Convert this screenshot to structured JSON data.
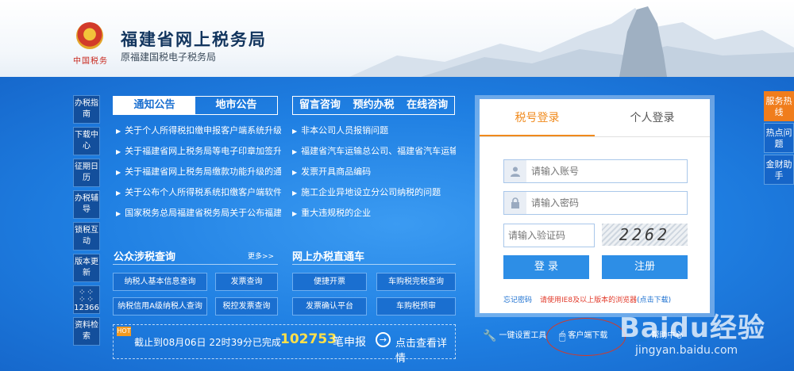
{
  "header": {
    "emblem_text": "中国税务",
    "title": "福建省网上税务局",
    "subtitle": "原福建国税电子税务局"
  },
  "sidenav": [
    {
      "label": "办税指南"
    },
    {
      "label": "下载中心"
    },
    {
      "label": "征期日历"
    },
    {
      "label": "办税辅导"
    },
    {
      "label": "锁税互动"
    },
    {
      "label": "版本更新"
    },
    {
      "label": "12366"
    },
    {
      "label": "资料检索"
    }
  ],
  "notice_tabs": [
    "通知公告",
    "地市公告"
  ],
  "notices": [
    "关于个人所得税扣缴申报客户端系统升级",
    "关于福建省网上税务局等电子印章加签升",
    "关于福建省网上税务局缴款功能升级的通",
    "关于公布个人所得税系统扣缴客户端软件",
    "国家税务总局福建省税务局关于公布福建"
  ],
  "consult_tabs": [
    "留言咨询",
    "预约办税",
    "在线咨询"
  ],
  "consults": [
    "非本公司人员报销问题",
    "福建省汽车运输总公司、福建省汽车运输",
    "发票开具商品编码",
    "施工企业异地设立分公司纳税的问题",
    "重大违规税的企业"
  ],
  "public_query": {
    "title": "公众涉税查询",
    "more": "更多>>",
    "buttons": [
      "纳税人基本信息查询",
      "发票查询",
      "纳税信用A级纳税人查询",
      "税控发票查询"
    ]
  },
  "express": {
    "title": "网上办税直通车",
    "buttons": [
      "便捷开票",
      "车购税完税查询",
      "发票确认平台",
      "车购税预审"
    ]
  },
  "stats": {
    "badge": "HOT",
    "prefix": "截止到08月06日 22时39分已完成",
    "count": "102753",
    "suffix": "笔申报",
    "detail": "点击查看详情"
  },
  "login": {
    "tabs": [
      "税号登录",
      "个人登录"
    ],
    "account_placeholder": "请输入账号",
    "password_placeholder": "请输入密码",
    "captcha_placeholder": "请输入验证码",
    "captcha_text": "2262",
    "login_button": "登 录",
    "register_button": "注册",
    "forgot": "忘记密码",
    "browser_tip": "请使用IE8及以上版本的浏览器",
    "browser_tip_link": "(点击下载)"
  },
  "tools": [
    {
      "icon": "wrench-icon",
      "label": "一键设置工具"
    },
    {
      "icon": "mouse-icon",
      "label": "客户端下载"
    },
    {
      "icon": "person-icon",
      "label": "帮助中心"
    }
  ],
  "rfloat": [
    "服务热线",
    "热点问题",
    "金财助手"
  ],
  "watermark": {
    "big": "Baidu经验",
    "small": "jingyan.baidu.com"
  },
  "colors": {
    "brand_blue": "#1c7ce0",
    "accent_orange": "#f08a1c",
    "highlight_yellow": "#ffe04a",
    "warn_red": "#e23a2a"
  }
}
